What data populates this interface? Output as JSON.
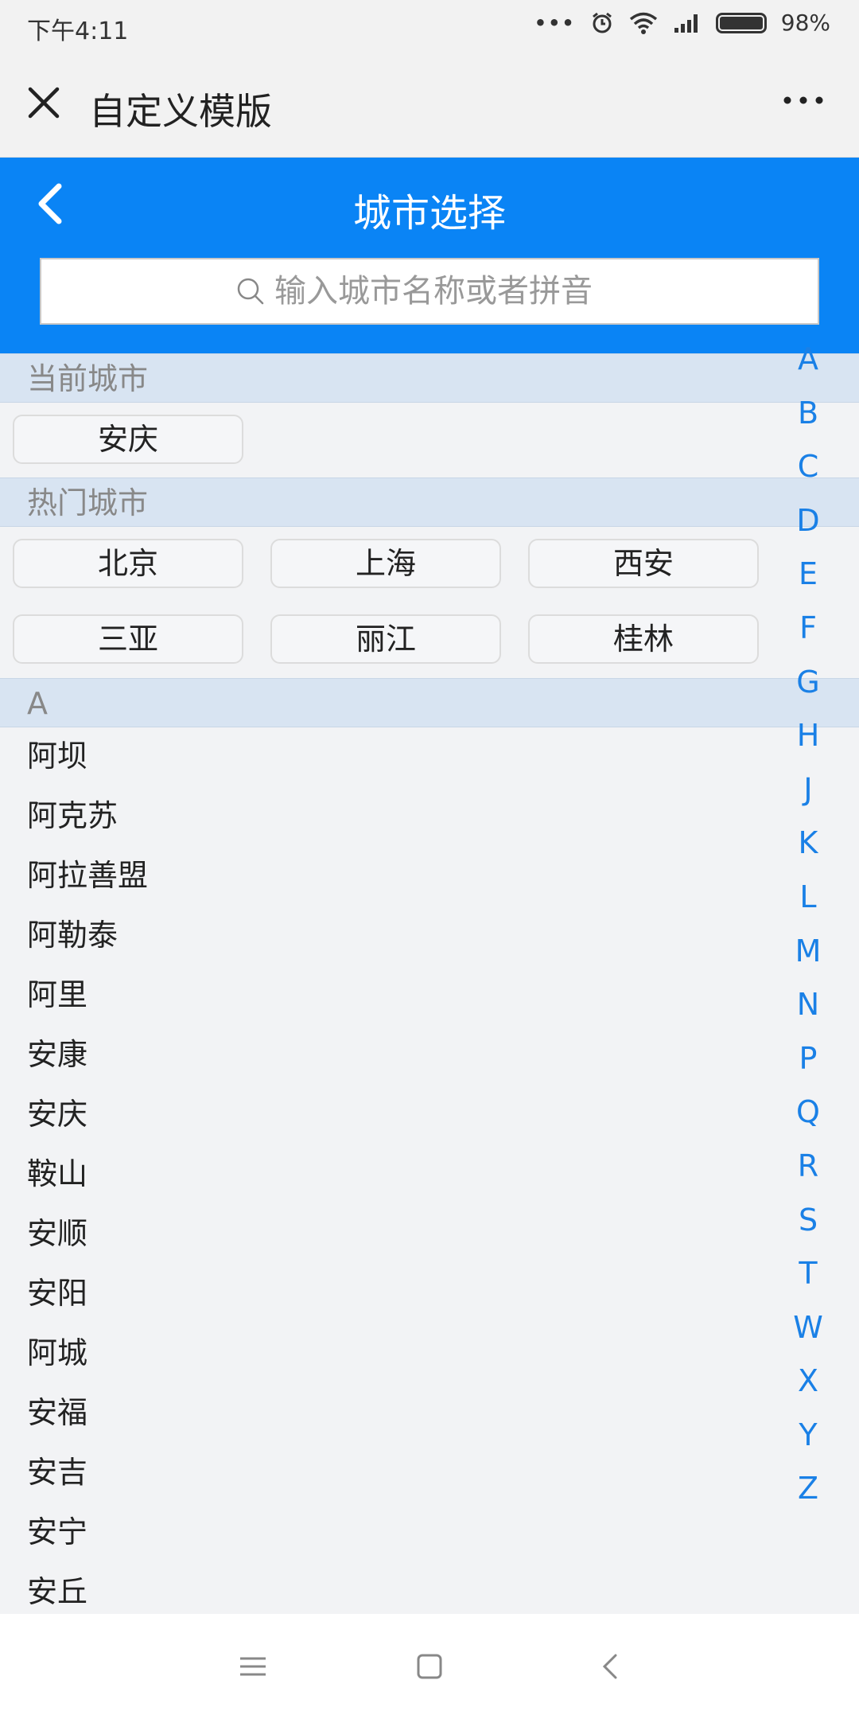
{
  "status": {
    "time": "下午4:11",
    "battery": "98%"
  },
  "titlebar": {
    "title": "自定义模版"
  },
  "header": {
    "title": "城市选择"
  },
  "search": {
    "placeholder": "输入城市名称或者拼音"
  },
  "current": {
    "label": "当前城市",
    "city": "安庆"
  },
  "hot": {
    "label": "热门城市",
    "cities": [
      "北京",
      "上海",
      "西安",
      "三亚",
      "丽江",
      "桂林"
    ]
  },
  "groupA": {
    "label": "A",
    "cities": [
      "阿坝",
      "阿克苏",
      "阿拉善盟",
      "阿勒泰",
      "阿里",
      "安康",
      "安庆",
      "鞍山",
      "安顺",
      "安阳",
      "阿城",
      "安福",
      "安吉",
      "安宁",
      "安丘"
    ]
  },
  "alphabet": [
    "A",
    "B",
    "C",
    "D",
    "E",
    "F",
    "G",
    "H",
    "J",
    "K",
    "L",
    "M",
    "N",
    "P",
    "Q",
    "R",
    "S",
    "T",
    "W",
    "X",
    "Y",
    "Z"
  ],
  "colors": {
    "accent": "#0a84f5",
    "section": "#d8e4f2",
    "index": "#1a80e6"
  }
}
